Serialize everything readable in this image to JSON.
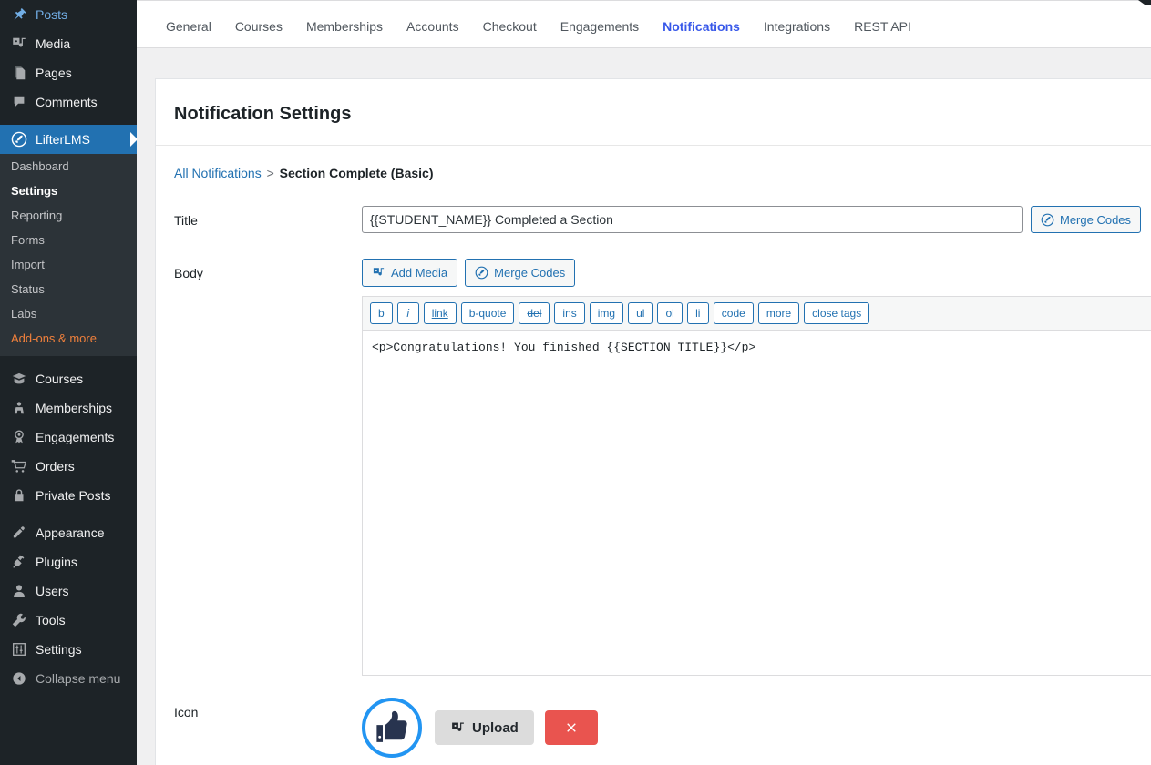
{
  "theme": {
    "sidebar_bg": "#1d2327",
    "submenu_bg": "#2c3338",
    "accent_blue": "#2271b1",
    "tab_active_blue": "#3858e9",
    "addons_orange": "#f0803c",
    "icon_ring_blue": "#2295f2",
    "remove_red": "#e9544f",
    "upload_gray": "#dcdcdc"
  },
  "sidebar": {
    "items": [
      {
        "label": "Posts",
        "icon": "pin-icon",
        "state": "default"
      },
      {
        "label": "Media",
        "icon": "media-icon",
        "state": "default"
      },
      {
        "label": "Pages",
        "icon": "pages-icon",
        "state": "default"
      },
      {
        "label": "Comments",
        "icon": "comments-icon",
        "state": "default"
      },
      {
        "label": "LifterLMS",
        "icon": "lifterlms-icon",
        "state": "current"
      },
      {
        "label": "Courses",
        "icon": "graduation-cap-icon",
        "state": "default"
      },
      {
        "label": "Memberships",
        "icon": "groups-icon",
        "state": "default"
      },
      {
        "label": "Engagements",
        "icon": "award-icon",
        "state": "default"
      },
      {
        "label": "Orders",
        "icon": "cart-icon",
        "state": "default"
      },
      {
        "label": "Private Posts",
        "icon": "lock-icon",
        "state": "default"
      },
      {
        "label": "Appearance",
        "icon": "brush-icon",
        "state": "default"
      },
      {
        "label": "Plugins",
        "icon": "plug-icon",
        "state": "default"
      },
      {
        "label": "Users",
        "icon": "user-icon",
        "state": "default"
      },
      {
        "label": "Tools",
        "icon": "wrench-icon",
        "state": "default"
      },
      {
        "label": "Settings",
        "icon": "sliders-icon",
        "state": "default"
      },
      {
        "label": "Collapse menu",
        "icon": "collapse-arrow-icon",
        "state": "default"
      }
    ],
    "submenu": [
      {
        "label": "Dashboard",
        "state": "default"
      },
      {
        "label": "Settings",
        "state": "current"
      },
      {
        "label": "Reporting",
        "state": "default"
      },
      {
        "label": "Forms",
        "state": "default"
      },
      {
        "label": "Import",
        "state": "default"
      },
      {
        "label": "Status",
        "state": "default"
      },
      {
        "label": "Labs",
        "state": "default"
      },
      {
        "label": "Add-ons & more",
        "state": "addons"
      }
    ]
  },
  "tabs": [
    {
      "label": "General",
      "active": false
    },
    {
      "label": "Courses",
      "active": false
    },
    {
      "label": "Memberships",
      "active": false
    },
    {
      "label": "Accounts",
      "active": false
    },
    {
      "label": "Checkout",
      "active": false
    },
    {
      "label": "Engagements",
      "active": false
    },
    {
      "label": "Notifications",
      "active": true
    },
    {
      "label": "Integrations",
      "active": false
    },
    {
      "label": "REST API",
      "active": false
    }
  ],
  "panel": {
    "title": "Notification Settings",
    "breadcrumb": {
      "link_label": "All Notifications",
      "separator": ">",
      "current": "Section Complete (Basic)"
    },
    "fields": {
      "title": {
        "label": "Title",
        "value": "{{STUDENT_NAME}} Completed a Section",
        "placeholder": "",
        "merge_codes_label": "Merge Codes"
      },
      "body": {
        "label": "Body",
        "add_media_label": "Add Media",
        "merge_codes_label": "Merge Codes",
        "content": "<p>Congratulations! You finished {{SECTION_TITLE}}</p>",
        "quicktags": [
          "b",
          "i",
          "link",
          "b-quote",
          "del",
          "ins",
          "img",
          "ul",
          "ol",
          "li",
          "code",
          "more",
          "close tags"
        ]
      },
      "icon": {
        "label": "Icon",
        "preview_icon": "thumbs-up-icon",
        "upload_label": "Upload",
        "remove_label": "×"
      }
    }
  }
}
